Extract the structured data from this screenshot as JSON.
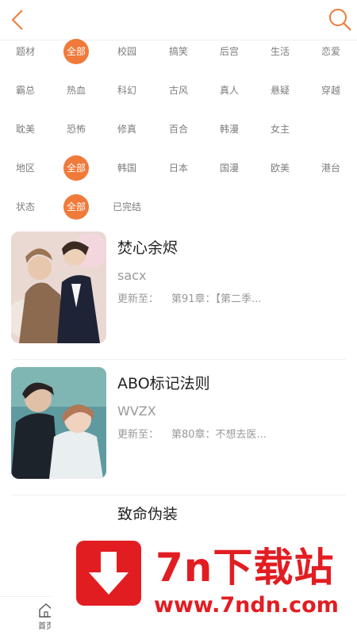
{
  "header": {
    "back_icon": "chevron-left-icon",
    "search_icon": "search-icon",
    "accent": "#f07a3a"
  },
  "filters": {
    "row1": [
      "题材",
      "全部",
      "校园",
      "搞笑",
      "后宫",
      "生活",
      "恋爱"
    ],
    "row2": [
      "霸总",
      "热血",
      "科幻",
      "古风",
      "真人",
      "悬疑",
      "穿越"
    ],
    "row3": [
      "耽美",
      "恐怖",
      "修真",
      "百合",
      "韩漫",
      "女主"
    ],
    "row4": [
      "地区",
      "全部",
      "韩国",
      "日本",
      "国漫",
      "欧美",
      "港台"
    ],
    "row5": [
      "状态",
      "全部",
      "已完结"
    ]
  },
  "comics": [
    {
      "title": "焚心余烬",
      "author": "sacx",
      "update_label": "更新至：",
      "chapter": "第91章：【第二季..."
    },
    {
      "title": "ABO标记法则",
      "author": "WVZX",
      "update_label": "更新至：",
      "chapter": "第80章：不想去医..."
    },
    {
      "title": "致命伪装"
    }
  ],
  "tabbar": {
    "home_label": "首页"
  },
  "ad": {
    "name": "7n下载站",
    "url": "www.7ndn.com",
    "color": "#e21d22"
  }
}
